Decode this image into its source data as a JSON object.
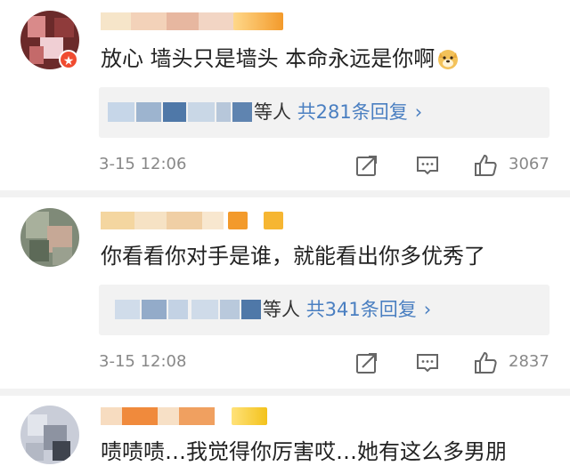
{
  "comments": [
    {
      "text": "放心 墙头只是墙头 本命永远是你啊",
      "emoji": "dog-face-emoji",
      "reply_suffix": "等人",
      "reply_count": "共281条回复",
      "date": "3-15 12:06",
      "likes": "3067"
    },
    {
      "text": "你看看你对手是谁，就能看出你多优秀了",
      "reply_suffix": "等人",
      "reply_count": "共341条回复",
      "date": "3-15 12:08",
      "likes": "2837"
    },
    {
      "text": "啧啧啧…我觉得你厉害哎…她有这么多男朋"
    }
  ],
  "reply_chevron": "›",
  "colors": {
    "link_blue": "#4a7fc1",
    "meta_gray": "#888888",
    "reply_bg": "#f2f2f2",
    "badge_orange": "#f39a2b",
    "vip_red": "#f04b30"
  },
  "icons": [
    "verified-badge-icon",
    "repost-icon",
    "comment-icon",
    "like-icon",
    "chevron-right-icon"
  ]
}
